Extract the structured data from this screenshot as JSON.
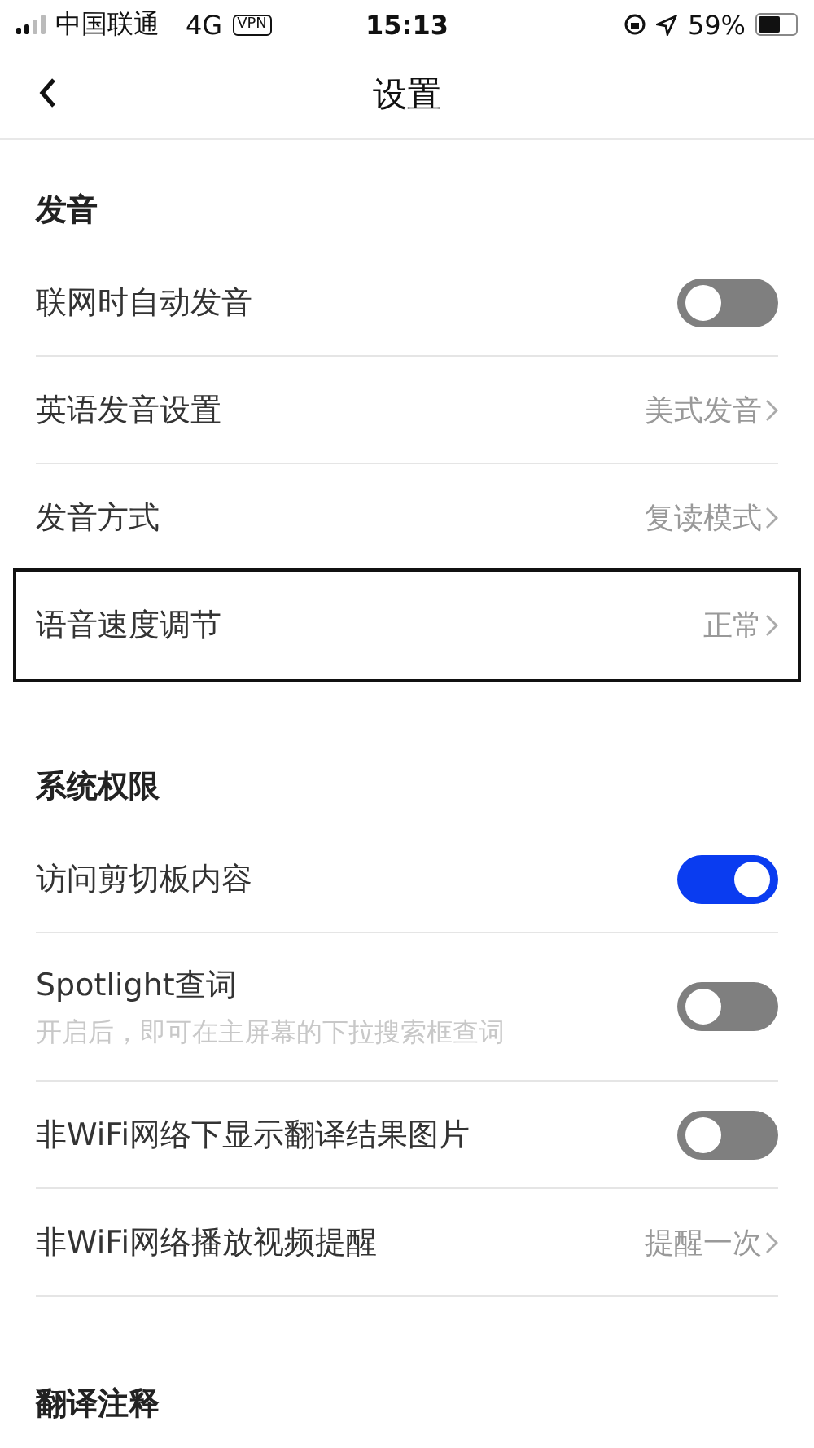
{
  "status_bar": {
    "carrier": "中国联通",
    "network": "4G",
    "vpn": "VPN",
    "time": "15:13",
    "battery": "59%"
  },
  "nav": {
    "title": "设置"
  },
  "sections": [
    {
      "title": "发音",
      "rows": [
        {
          "kind": "toggle",
          "label": "联网时自动发音",
          "on": false,
          "highlighted": false
        },
        {
          "kind": "link",
          "label": "英语发音设置",
          "value": "美式发音",
          "highlighted": false
        },
        {
          "kind": "link",
          "label": "发音方式",
          "value": "复读模式",
          "highlighted": false
        },
        {
          "kind": "link",
          "label": "语音速度调节",
          "value": "正常",
          "highlighted": true
        }
      ]
    },
    {
      "title": "系统权限",
      "rows": [
        {
          "kind": "toggle",
          "label": "访问剪切板内容",
          "on": true,
          "highlighted": false
        },
        {
          "kind": "toggle",
          "label": "Spotlight查词",
          "hint": "开启后，即可在主屏幕的下拉搜索框查词",
          "on": false,
          "highlighted": false
        },
        {
          "kind": "toggle",
          "label": "非WiFi网络下显示翻译结果图片",
          "on": false,
          "highlighted": false
        },
        {
          "kind": "link",
          "label": "非WiFi网络播放视频提醒",
          "value": "提醒一次",
          "highlighted": false
        }
      ]
    },
    {
      "title": "翻译注释"
    }
  ]
}
